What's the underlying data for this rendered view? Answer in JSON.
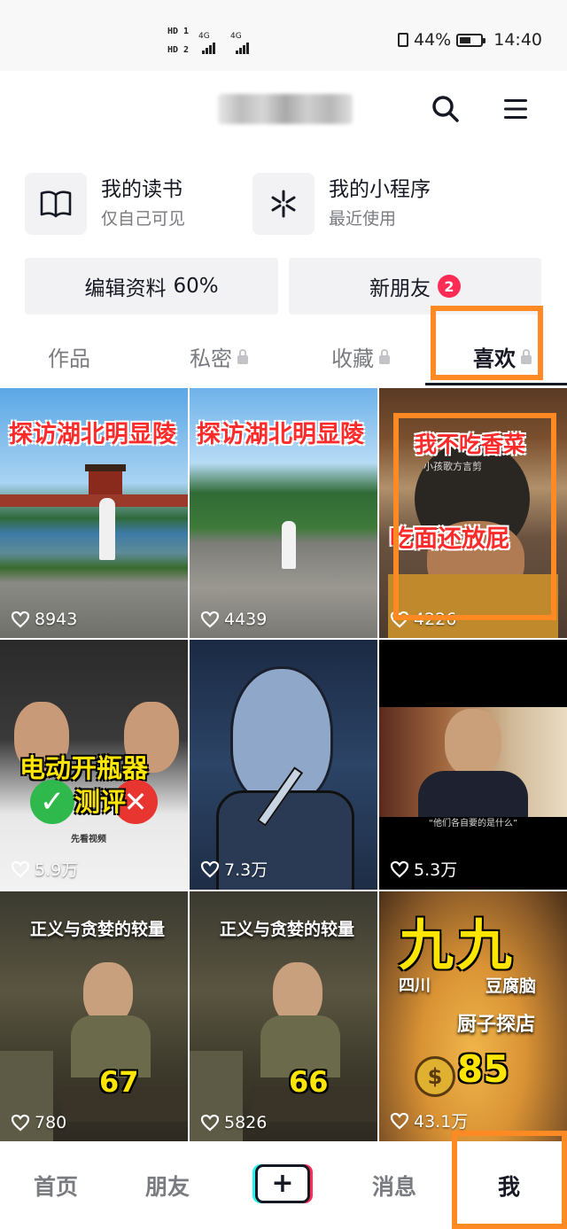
{
  "status_bar": {
    "hd1": "HD 1",
    "hd2": "HD 2",
    "net1": "4G",
    "net2": "4G",
    "battery": "44%",
    "time": "14:40"
  },
  "header": {
    "search_icon": "search-icon",
    "menu_icon": "hamburger-menu-icon"
  },
  "cards": [
    {
      "title": "我的读书",
      "subtitle": "仅自己可见",
      "icon": "book-icon"
    },
    {
      "title": "我的小程序",
      "subtitle": "最近使用",
      "icon": "mini-program-icon"
    }
  ],
  "buttons": {
    "edit_profile": "编辑资料",
    "edit_progress": "60%",
    "new_friends": "新朋友",
    "new_friends_badge": "2"
  },
  "tabs": [
    {
      "label": "作品",
      "locked": false
    },
    {
      "label": "私密",
      "locked": true
    },
    {
      "label": "收藏",
      "locked": true
    },
    {
      "label": "喜欢",
      "locked": true,
      "active": true
    }
  ],
  "videos": [
    {
      "likes": "8943",
      "caption": "探访湖北明显陵"
    },
    {
      "likes": "4439",
      "caption": "探访湖北明显陵"
    },
    {
      "likes": "4226",
      "caption_top": "我不吃香菜",
      "caption_bottom": "吃面还放屁",
      "watermark": "小孩歌方言剪"
    },
    {
      "likes": "5.9万",
      "caption_top": "电动开瓶器",
      "caption_bottom": "测评",
      "sub_caption": "先看视频"
    },
    {
      "likes": "7.3万"
    },
    {
      "likes": "5.3万",
      "subtitle": "“他们各自要的是什么”"
    },
    {
      "likes": "780",
      "caption": "正义与贪婪的较量",
      "number": "67"
    },
    {
      "likes": "5826",
      "caption": "正义与贪婪的较量",
      "number": "66"
    },
    {
      "likes": "43.1万",
      "caption_big": "九九",
      "side1": "四川",
      "side2": "豆腐脑",
      "line2": "厨子探店",
      "price": "85"
    }
  ],
  "bottom_nav": [
    {
      "label": "首页"
    },
    {
      "label": "朋友"
    },
    {
      "label": "+"
    },
    {
      "label": "消息"
    },
    {
      "label": "我",
      "active": true
    }
  ],
  "colors": {
    "accent": "#fe2c55",
    "highlight": "#ff8a24",
    "text_primary": "#161823",
    "text_secondary": "#7a7b80"
  }
}
